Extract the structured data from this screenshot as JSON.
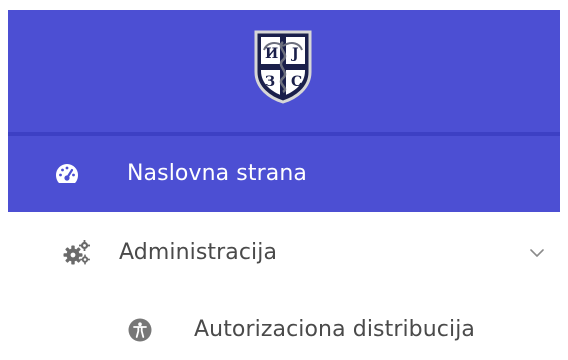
{
  "header": {
    "logo": {
      "icon": "medical-caduceus-shield-logo",
      "letters": [
        "И",
        "Ј",
        "З",
        "С"
      ]
    }
  },
  "nav": {
    "active_item": {
      "label": "Naslovna strana",
      "icon": "tachometer-icon"
    },
    "administration": {
      "label": "Administracija",
      "icon": "gears-icon",
      "expand_icon": "chevron-down-icon"
    },
    "sub_items": [
      {
        "label": "Autorizaciona distribucija",
        "icon": "universal-access-icon"
      }
    ]
  },
  "colors": {
    "brand": "#4c4fd3",
    "text": "#4a4a4a",
    "active_text": "#ffffff"
  }
}
